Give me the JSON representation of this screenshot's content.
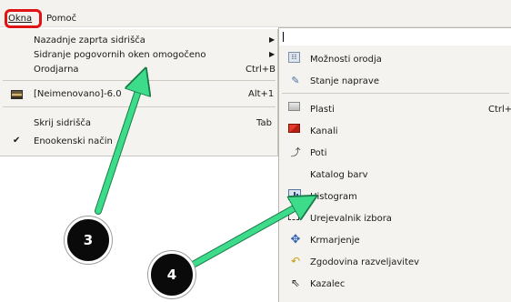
{
  "menubar": {
    "okna": "Okna",
    "pomoc": "Pomoč"
  },
  "okna_menu": {
    "items": [
      {
        "label": "Nazadnje zaprta sidrišča",
        "accel": "",
        "has_submenu": true
      },
      {
        "label": "Sidranje pogovornih oken omogočeno",
        "accel": "",
        "has_submenu": true
      },
      {
        "label": "Orodjarna",
        "accel": "Ctrl+B",
        "has_submenu": false
      },
      {
        "label": "[Neimenovano]-6.0",
        "accel": "Alt+1",
        "icon": "image-thumbnail-icon"
      },
      {
        "label": "Skrij sidrišča",
        "accel": "Tab"
      },
      {
        "label": "Enookenski način",
        "accel": "",
        "checked": true
      }
    ]
  },
  "submenu": {
    "items": [
      {
        "label": "Možnosti orodja",
        "icon": "tool-options-icon"
      },
      {
        "label": "Stanje naprave",
        "icon": "device-status-icon"
      },
      {
        "label": "Plasti",
        "accel": "Ctrl+",
        "icon": "layers-icon"
      },
      {
        "label": "Kanali",
        "icon": "channels-icon"
      },
      {
        "label": "Poti",
        "icon": "paths-icon"
      },
      {
        "label": "Katalog barv",
        "icon": "color-catalog-icon"
      },
      {
        "label": "Histogram",
        "icon": "histogram-icon"
      },
      {
        "label": "Urejevalnik izbora",
        "icon": "selection-editor-icon"
      },
      {
        "label": "Krmarjenje",
        "icon": "navigation-icon"
      },
      {
        "label": "Zgodovina razveljavitev",
        "icon": "undo-history-icon"
      },
      {
        "label": "Kazalec",
        "icon": "pointer-icon"
      }
    ]
  },
  "callouts": [
    {
      "number": "3"
    },
    {
      "number": "4"
    }
  ],
  "colors": {
    "highlight_ring": "#e01414",
    "callout_arrow": "#3ddc8a",
    "badge_bg": "#0a0a0a"
  }
}
